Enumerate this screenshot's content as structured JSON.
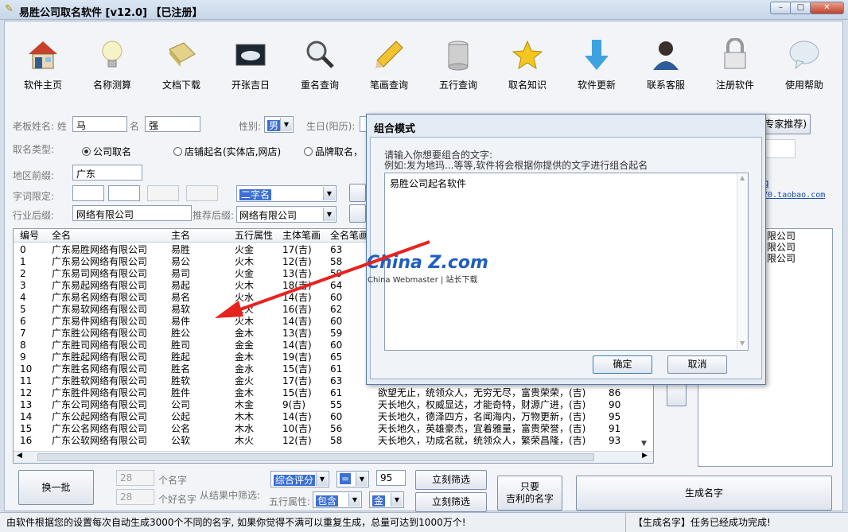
{
  "window": {
    "title": "易胜公司取名软件 [v12.0] 【已注册】",
    "controls": {
      "minimize": "–",
      "maximize": "□",
      "close": "✕"
    }
  },
  "toolbar": {
    "items": [
      {
        "label": "软件主页",
        "icon": "house-icon"
      },
      {
        "label": "名称测算",
        "icon": "lightbulb-icon"
      },
      {
        "label": "文档下载",
        "icon": "book-icon"
      },
      {
        "label": "开张吉日",
        "icon": "sunrise-icon"
      },
      {
        "label": "重名查询",
        "icon": "magnifier-icon"
      },
      {
        "label": "笔画查询",
        "icon": "pencil-icon"
      },
      {
        "label": "五行查询",
        "icon": "database-icon"
      },
      {
        "label": "取名知识",
        "icon": "star-icon"
      },
      {
        "label": "软件更新",
        "icon": "down-arrow-icon"
      },
      {
        "label": "联系客服",
        "icon": "person-icon"
      },
      {
        "label": "注册软件",
        "icon": "lock-icon"
      },
      {
        "label": "使用帮助",
        "icon": "speech-bubble-icon"
      }
    ]
  },
  "form": {
    "owner_name_label": "老板姓名: 姓",
    "surname": "马",
    "given_label": "名",
    "given_name": "强",
    "gender_label": "性别:",
    "gender": "男",
    "birth_label": "生日(阳历):",
    "expert_btn": "专家推荐)",
    "type_label": "取名类型:",
    "type_options": [
      "公司取名",
      "店铺起名(实体店,网店)",
      "品牌取名，"
    ],
    "region_label": "地区前缀:",
    "region": "广东",
    "word_limit_label": "字词限定:",
    "word_count_select": "二字名",
    "industry_label": "行业后缀:",
    "industry": "网络有限公司",
    "recommend_label": "推荐后缀:",
    "recommend_select": "网络有限公司"
  },
  "right_panel": {
    "link1": "g",
    "link2": "70.taobao.com",
    "list": [
      "限公司",
      "限公司",
      "限公司"
    ]
  },
  "table": {
    "headers": [
      "编号",
      "全名",
      "主名",
      "五行属性",
      "主体笔画",
      "全名笔画"
    ],
    "rows": [
      [
        "0",
        "广东易胜网络有限公司",
        "易胜",
        "火金",
        "17(吉)",
        "63"
      ],
      [
        "1",
        "广东易公网络有限公司",
        "易公",
        "火木",
        "12(吉)",
        "58"
      ],
      [
        "2",
        "广东易司网络有限公司",
        "易司",
        "火金",
        "13(吉)",
        "59"
      ],
      [
        "3",
        "广东易起网络有限公司",
        "易起",
        "火木",
        "18(吉)",
        "64"
      ],
      [
        "4",
        "广东易名网络有限公司",
        "易名",
        "火水",
        "14(吉)",
        "60"
      ],
      [
        "5",
        "广东易软网络有限公司",
        "易软",
        "火火",
        "16(吉)",
        "62"
      ],
      [
        "6",
        "广东易件网络有限公司",
        "易件",
        "火木",
        "14(吉)",
        "60"
      ],
      [
        "7",
        "广东胜公网络有限公司",
        "胜公",
        "金木",
        "13(吉)",
        "59"
      ],
      [
        "8",
        "广东胜司网络有限公司",
        "胜司",
        "金金",
        "14(吉)",
        "60"
      ],
      [
        "9",
        "广东胜起网络有限公司",
        "胜起",
        "金木",
        "19(吉)",
        "65"
      ],
      [
        "10",
        "广东胜名网络有限公司",
        "胜名",
        "金水",
        "15(吉)",
        "61"
      ],
      [
        "11",
        "广东胜软网络有限公司",
        "胜软",
        "金火",
        "17(吉)",
        "63"
      ],
      [
        "12",
        "广东胜件网络有限公司",
        "胜件",
        "金木",
        "15(吉)",
        "61"
      ],
      [
        "13",
        "广东公司网络有限公司",
        "公司",
        "木金",
        "9(吉)",
        "55"
      ],
      [
        "14",
        "广东公起网络有限公司",
        "公起",
        "木木",
        "14(吉)",
        "60"
      ],
      [
        "15",
        "广东公名网络有限公司",
        "公名",
        "木水",
        "10(吉)",
        "56"
      ],
      [
        "16",
        "广东公软网络有限公司",
        "公软",
        "木火",
        "12(吉)",
        "58"
      ]
    ],
    "extra_rows": [
      {
        "desc": "欲望无止，统领众人，无穷无尽，富贵荣荣，(吉)",
        "score": "86"
      },
      {
        "desc": "天长地久，权威显达，才能奇特，财源广进，(吉)",
        "score": "90"
      },
      {
        "desc": "天长地久，德泽四方，名闻海内，万物更新，(吉)",
        "score": "95"
      },
      {
        "desc": "天长地久，英雄豪杰，宜着雅量，富贵荣誉，(吉)",
        "score": "91"
      },
      {
        "desc": "天长地久，功成名就，统领众人，繁荣昌隆，(吉)",
        "score": "93"
      }
    ]
  },
  "bottom": {
    "batch_btn": "换一批",
    "count1": "28",
    "count1_label": "个名字",
    "count2": "28",
    "count2_label": "个好名字",
    "filter_label": "从结果中筛选:",
    "score_select": "综合评分",
    "op_select": "=",
    "score_value": "95",
    "filter_btn1": "立刻筛选",
    "wuxing_label": "五行属性:",
    "wuxing_select": "包含",
    "wuxing_value": "金",
    "filter_btn2": "立刻筛选",
    "lucky_btn_line1": "只要",
    "lucky_btn_line2": "吉利的名字",
    "generate_btn": "生成名字"
  },
  "status": {
    "left": "由软件根据您的设置每次自动生成3000个不同的名字, 如果你觉得不满可以重复生成，总量可达到1000万个!",
    "right": "【生成名字】任务已经成功完成!"
  },
  "dialog": {
    "title": "组合模式",
    "prompt1": "请输入你想要组合的文字:",
    "prompt2": "例如:发为地玛...等等,软件将会根据你提供的文字进行组合起名",
    "text": "易胜公司起名软件",
    "ok": "确定",
    "cancel": "取消"
  },
  "watermark": {
    "main": "China Z.com",
    "sub": "China Webmaster | 站长下载"
  },
  "colors": {
    "accent": "#3b6fd4",
    "arrow": "#e8231f"
  }
}
